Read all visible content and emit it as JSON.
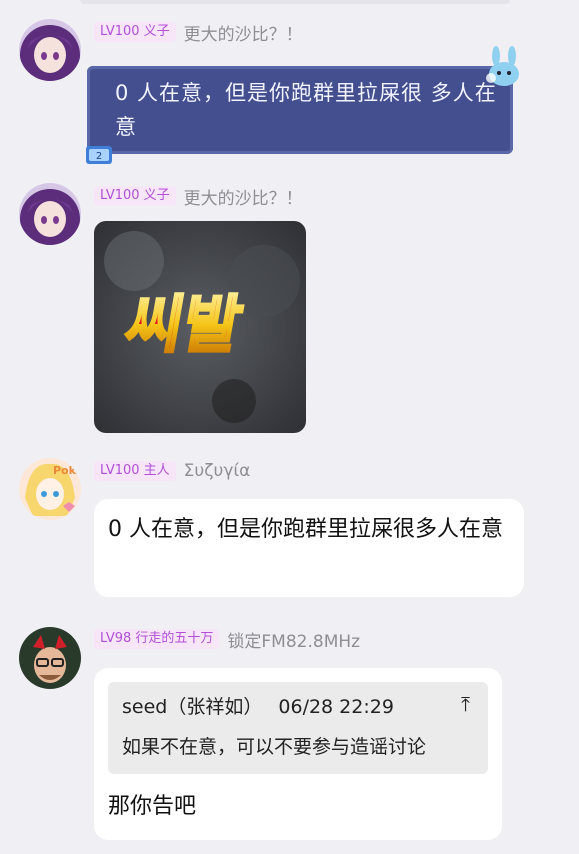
{
  "messages": [
    {
      "level_badge": "LV100 义子",
      "nickname": "更大的沙比？！",
      "text": "0 人在意，但是你跑群里拉屎很 多人在意",
      "decor_tag": "2"
    },
    {
      "level_badge": "LV100 义子",
      "nickname": "更大的沙比？！",
      "image_text": "씨발"
    },
    {
      "level_badge": "LV100 主人",
      "nickname": "Συζυγία",
      "avatar_text": "Poki",
      "text": "0 人在意，但是你跑群里拉屎很多人在意"
    },
    {
      "level_badge": "LV98 行走的五十万",
      "nickname": "锁定FM82.8MHz",
      "quote": {
        "author": "seed（张祥如）",
        "time": "06/28 22:29",
        "jump_icon": "⤒",
        "text": "如果不在意，可以不要参与造谣讨论"
      },
      "text": "那你告吧"
    }
  ],
  "colors": {
    "background": "#efeff4",
    "badge_text": "#b24fd6",
    "badge_bg": "#f6e6f8",
    "themed_bubble": "#434f8e",
    "bubble": "#ffffff",
    "quote_bg": "#ebebeb"
  },
  "icons": [
    "anime-avatar",
    "bunny-sticker-icon",
    "stack-badge-icon",
    "jump-to-message-icon"
  ]
}
